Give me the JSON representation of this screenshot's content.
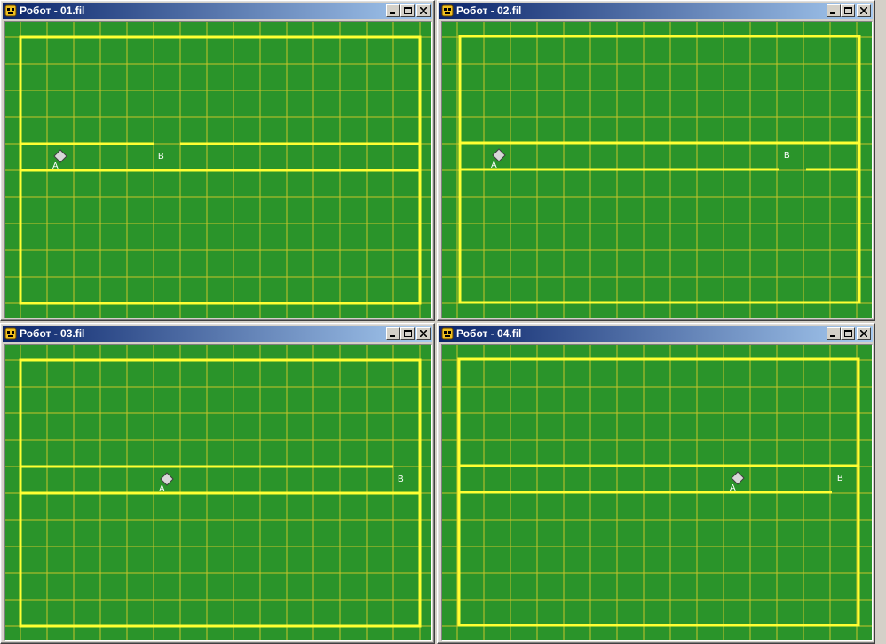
{
  "windows": [
    {
      "title": "Робот - 01.fil",
      "label_a": "A",
      "label_b": "B"
    },
    {
      "title": "Робот - 02.fil",
      "label_a": "A",
      "label_b": "B"
    },
    {
      "title": "Робот - 03.fil",
      "label_a": "A",
      "label_b": "B"
    },
    {
      "title": "Робот - 04.fil",
      "label_a": "A",
      "label_b": "B"
    }
  ],
  "colors": {
    "field": "#2a942a",
    "grid": "#c6c32a",
    "wall": "#ffff33",
    "title_gradient_start": "#0a246a",
    "title_gradient_end": "#a6caf0"
  },
  "icons": {
    "app": "robot-face-icon",
    "minimize": "minimize-icon",
    "maximize": "maximize-icon",
    "close": "close-icon",
    "robot": "robot-diamond-icon"
  }
}
